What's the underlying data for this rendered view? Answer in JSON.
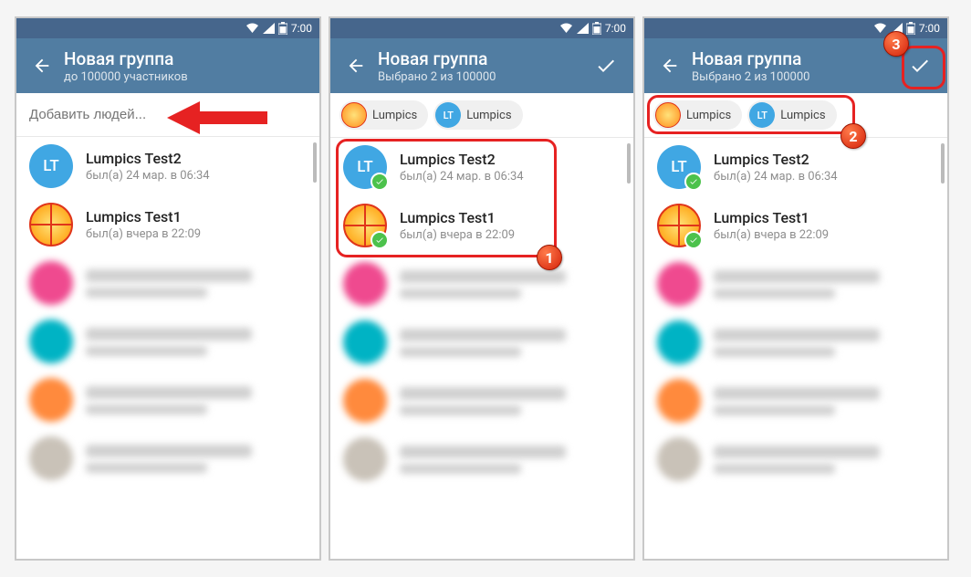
{
  "status": {
    "time": "7:00"
  },
  "screens": [
    {
      "title": "Новая группа",
      "subtitle": "до 100000 участников",
      "search_placeholder": "Добавить людей...",
      "show_confirm": false,
      "chips": [],
      "contacts": [
        {
          "name": "Lumpics Test2",
          "status": "был(а) 24 мар. в 06:34",
          "avatar_type": "initials",
          "initials": "LT",
          "color": "#40a7e3",
          "selected": false
        },
        {
          "name": "Lumpics Test1",
          "status": "был(а) вчера в 22:09",
          "avatar_type": "orange",
          "selected": false
        }
      ]
    },
    {
      "title": "Новая группа",
      "subtitle": "Выбрано 2 из 100000",
      "show_confirm": true,
      "chips": [
        {
          "label": "Lumpics",
          "avatar_type": "orange"
        },
        {
          "label": "Lumpics",
          "avatar_type": "initials",
          "initials": "LT",
          "color": "#40a7e3"
        }
      ],
      "contacts": [
        {
          "name": "Lumpics Test2",
          "status": "был(а) 24 мар. в 06:34",
          "avatar_type": "initials",
          "initials": "LT",
          "color": "#40a7e3",
          "selected": true
        },
        {
          "name": "Lumpics Test1",
          "status": "был(а) вчера в 22:09",
          "avatar_type": "orange",
          "selected": true
        }
      ]
    },
    {
      "title": "Новая группа",
      "subtitle": "Выбрано 2 из 100000",
      "show_confirm": true,
      "chips": [
        {
          "label": "Lumpics",
          "avatar_type": "orange"
        },
        {
          "label": "Lumpics",
          "avatar_type": "initials",
          "initials": "LT",
          "color": "#40a7e3"
        }
      ],
      "contacts": [
        {
          "name": "Lumpics Test2",
          "status": "был(а) 24 мар. в 06:34",
          "avatar_type": "initials",
          "initials": "LT",
          "color": "#40a7e3",
          "selected": true
        },
        {
          "name": "Lumpics Test1",
          "status": "был(а) вчера в 22:09",
          "avatar_type": "orange",
          "selected": true
        }
      ]
    }
  ],
  "blurred_colors": [
    "#ef4a8f",
    "#00b3c4",
    "#ff8a3d",
    "#c9c2b8"
  ],
  "annotations": {
    "badge1": "1",
    "badge2": "2",
    "badge3": "3"
  }
}
